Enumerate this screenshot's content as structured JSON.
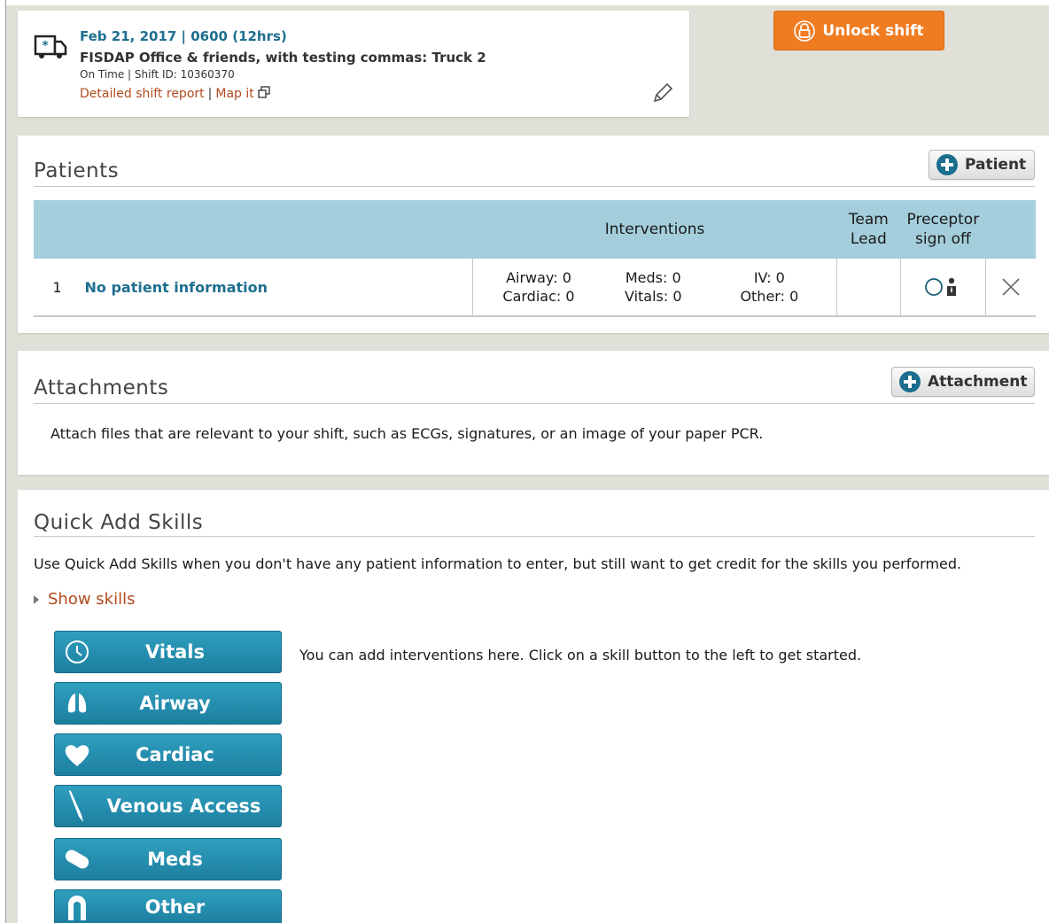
{
  "shift": {
    "date_line": "Feb 21, 2017 | 0600 (12hrs)",
    "place": "FISDAP Office & friends, with testing commas: Truck 2",
    "meta": "On Time | Shift ID: 10360370",
    "link_report": "Detailed shift report",
    "link_map": "Map it"
  },
  "unlock_button": "Unlock shift",
  "patients": {
    "title": "Patients",
    "add_button": "Patient",
    "headers": {
      "interventions": "Interventions",
      "team_lead_1": "Team",
      "team_lead_2": "Lead",
      "preceptor_1": "Preceptor",
      "preceptor_2": "sign off"
    },
    "rows": [
      {
        "index": "1",
        "name": "No patient information",
        "airway": "Airway: 0",
        "cardiac": "Cardiac: 0",
        "meds": "Meds: 0",
        "vitals": "Vitals: 0",
        "iv": "IV: 0",
        "other": "Other: 0"
      }
    ]
  },
  "attachments": {
    "title": "Attachments",
    "add_button": "Attachment",
    "description": "Attach files that are relevant to your shift, such as ECGs, signatures, or an image of your paper PCR."
  },
  "quick_add": {
    "title": "Quick Add Skills",
    "description": "Use Quick Add Skills when you don't have any patient information to enter, but still want to get credit for the skills you performed.",
    "show_skills": "Show skills",
    "hint": "You can add interventions here. Click on a skill button to the left to get started.",
    "buttons": [
      {
        "label": "Vitals",
        "icon": "clock-icon"
      },
      {
        "label": "Airway",
        "icon": "lungs-icon"
      },
      {
        "label": "Cardiac",
        "icon": "heart-icon"
      },
      {
        "label": "Venous Access",
        "icon": "needle-icon"
      },
      {
        "label": "Meds",
        "icon": "pill-icon"
      },
      {
        "label": "Other",
        "icon": "other-icon"
      }
    ]
  },
  "colors": {
    "accent_blue": "#1e6f8f",
    "link_orange": "#b04a1e",
    "unlock_orange": "#f07c22",
    "table_header": "#a4cedb",
    "skill_button": "#2390b2"
  }
}
